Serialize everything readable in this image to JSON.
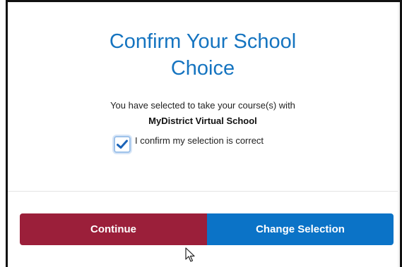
{
  "modal": {
    "title_line1": "Confirm Your School",
    "title_line2": "Choice",
    "message": "You have selected to take your course(s) with",
    "school_name": "MyDistrict Virtual School",
    "confirm_label": "I confirm my selection is correct",
    "confirm_checked": true,
    "continue_label": "Continue",
    "change_label": "Change Selection"
  },
  "colors": {
    "title": "#1574c0",
    "continue_button": "#9b1f3a",
    "change_button": "#0b73c7",
    "checkmark": "#1a63b8"
  },
  "icons": {
    "checkbox": "checkmark-icon",
    "cursor": "mouse-pointer-icon"
  }
}
